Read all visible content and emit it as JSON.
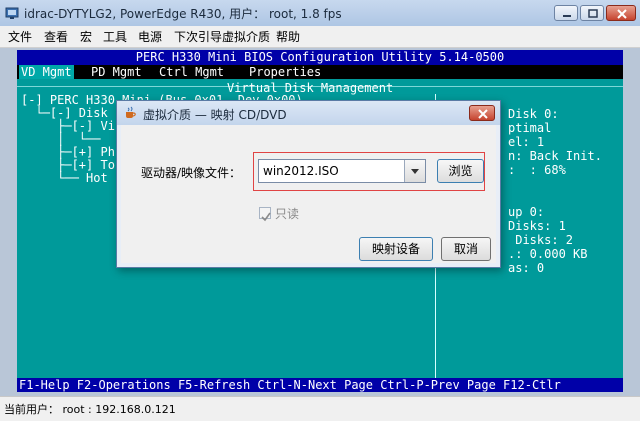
{
  "window": {
    "title": "idrac-DYTYLG2, PowerEdge R430, 用户： root, 1.8 fps"
  },
  "menu": [
    "文件",
    "查看",
    "宏",
    "工具",
    "电源",
    "下次引导",
    "虚拟介质",
    "帮助"
  ],
  "bios": {
    "header": "PERC H330 Mini BIOS Configuration Utility 5.14-0500",
    "tabs": [
      "VD Mgmt",
      "PD Mgmt",
      "Ctrl Mgmt",
      "Properties"
    ],
    "section_title": "Virtual Disk Management",
    "tree": [
      "[-] PERC H330 Mini (Bus 0x01, Dev 0x00)",
      "  └─[-] Disk",
      "     ├─[-] Vi",
      "     │  └──  I",
      "     ├─[+] Ph",
      "     ├─[+] To",
      "     └── Hot"
    ],
    "right_panel": [
      "Disk 0:",
      "ptimal",
      "el: 1",
      "n: Back Init.",
      ":  : 68%",
      "",
      "",
      "up 0:",
      "Disks: 1",
      " Disks: 2",
      ".: 0.000 KB",
      "as: 0"
    ],
    "footer": "F1-Help F2-Operations F5-Refresh Ctrl-N-Next Page Ctrl-P-Prev Page F12-Ctlr"
  },
  "dialog": {
    "title": "虚拟介质 — 映射 CD/DVD",
    "drive_label": "驱动器/映像文件：",
    "drive_value": "win2012.ISO",
    "browse_label": "浏览",
    "readonly_label": "只读",
    "readonly_checked": true,
    "map_label": "映射设备",
    "cancel_label": "取消"
  },
  "status": {
    "text": "当前用户： root : 192.168.0.121"
  },
  "colors": {
    "console_bg": "#009a9a",
    "header_bg": "#0000a8",
    "highlight": "#e04444"
  }
}
